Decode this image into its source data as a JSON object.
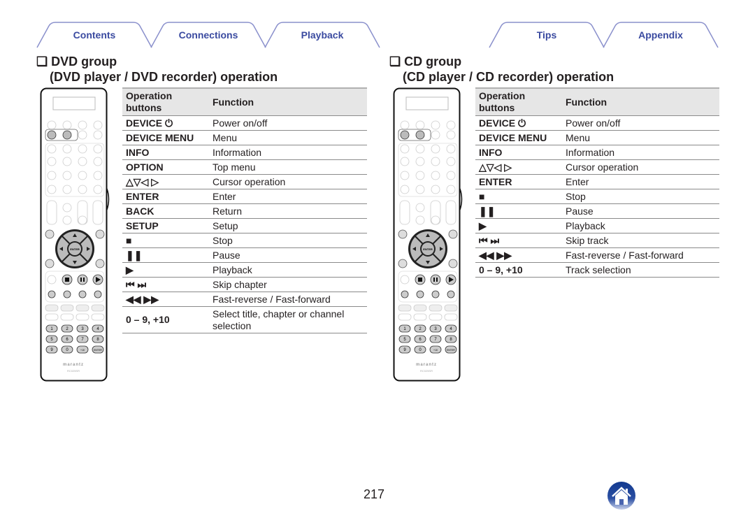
{
  "nav_tabs": [
    {
      "label": "Contents"
    },
    {
      "label": "Connections"
    },
    {
      "label": "Playback"
    },
    {
      "label": "Tips"
    },
    {
      "label": "Appendix"
    }
  ],
  "sections": [
    {
      "title_line1": "❑ DVD group",
      "title_line2": "(DVD player / DVD recorder) operation",
      "header": {
        "col1": "Operation buttons",
        "col2": "Function"
      },
      "rows": [
        {
          "op": "DEVICE ⏻",
          "fn": "Power on/off"
        },
        {
          "op": "DEVICE MENU",
          "fn": "Menu"
        },
        {
          "op": "INFO",
          "fn": "Information"
        },
        {
          "op": "OPTION",
          "fn": "Top menu"
        },
        {
          "op": "△▽◁ ▷",
          "fn": "Cursor operation"
        },
        {
          "op": "ENTER",
          "fn": "Enter"
        },
        {
          "op": "BACK",
          "fn": "Return"
        },
        {
          "op": "SETUP",
          "fn": "Setup"
        },
        {
          "op": "■",
          "fn": "Stop"
        },
        {
          "op": "❚❚",
          "fn": "Pause"
        },
        {
          "op": "▶",
          "fn": "Playback"
        },
        {
          "op": "⏮ ⏭",
          "fn": "Skip chapter"
        },
        {
          "op": "◀◀ ▶▶",
          "fn": "Fast-reverse / Fast-forward"
        },
        {
          "op": "0 – 9, +10",
          "fn": "Select title, chapter or channel selection"
        }
      ]
    },
    {
      "title_line1": "❑ CD group",
      "title_line2": "(CD player / CD recorder) operation",
      "header": {
        "col1": "Operation buttons",
        "col2": "Function"
      },
      "rows": [
        {
          "op": "DEVICE ⏻",
          "fn": "Power on/off"
        },
        {
          "op": "DEVICE MENU",
          "fn": "Menu"
        },
        {
          "op": "INFO",
          "fn": "Information"
        },
        {
          "op": "△▽◁ ▷",
          "fn": "Cursor operation"
        },
        {
          "op": "ENTER",
          "fn": "Enter"
        },
        {
          "op": "■",
          "fn": "Stop"
        },
        {
          "op": "❚❚",
          "fn": "Pause"
        },
        {
          "op": "▶",
          "fn": "Playback"
        },
        {
          "op": "⏮ ⏭",
          "fn": "Skip track"
        },
        {
          "op": "◀◀ ▶▶",
          "fn": "Fast-reverse / Fast-forward"
        },
        {
          "op": "0 – 9, +10",
          "fn": "Track selection"
        }
      ]
    }
  ],
  "remote": {
    "brand": "marantz",
    "model": "RC025SR",
    "number_keys": [
      "1",
      "2",
      "3",
      "4",
      "5",
      "6",
      "7",
      "8",
      "9",
      "0",
      "+10",
      "ENTER"
    ],
    "center_key": "ENTER"
  },
  "page_number": "217",
  "colors": {
    "tab_text": "#3a4aa0",
    "tab_border": "#8a90cc",
    "home_icon": "#1d3f94"
  },
  "icons": {
    "home": "home-icon"
  }
}
